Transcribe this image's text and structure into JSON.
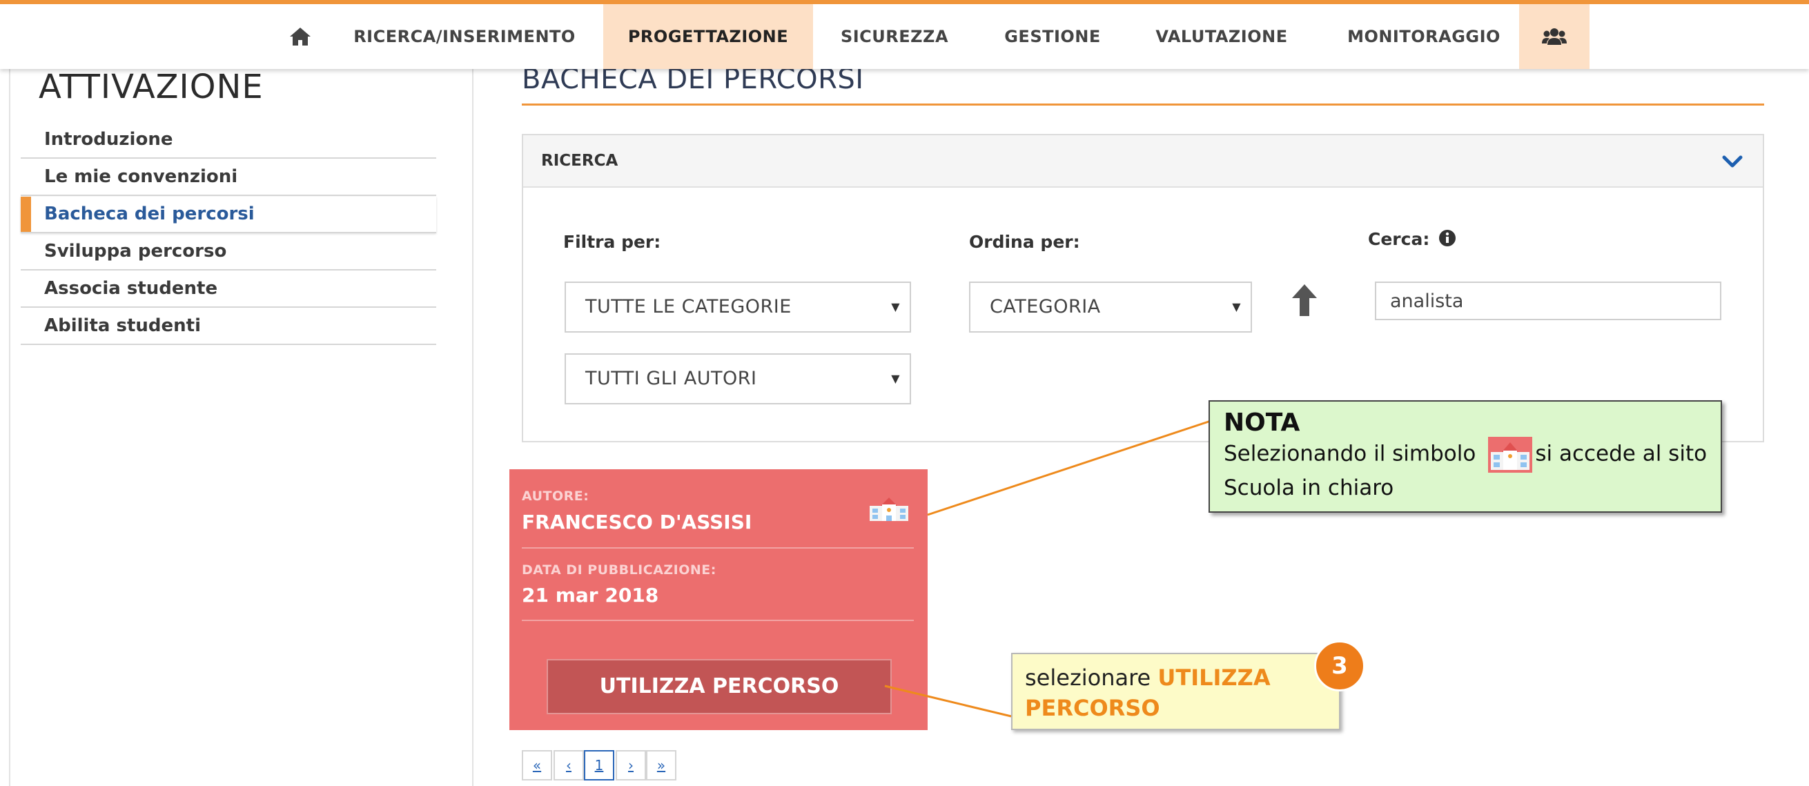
{
  "nav": {
    "items": [
      {
        "label": "RICERCA/INSERIMENTO"
      },
      {
        "label": "PROGETTAZIONE"
      },
      {
        "label": "SICUREZZA"
      },
      {
        "label": "GESTIONE"
      },
      {
        "label": "VALUTAZIONE"
      },
      {
        "label": "MONITORAGGIO"
      }
    ],
    "home_icon": "home-icon",
    "users_icon": "users-icon",
    "accent": "#f0953a",
    "highlight": "#fde0c6"
  },
  "sidebar": {
    "title": "ATTIVAZIONE",
    "items": [
      {
        "label": "Introduzione"
      },
      {
        "label": "Le mie convenzioni"
      },
      {
        "label": "Bacheca dei percorsi"
      },
      {
        "label": "Sviluppa percorso"
      },
      {
        "label": "Associa studente"
      },
      {
        "label": "Abilita studenti"
      }
    ]
  },
  "main": {
    "title": "BACHECA DEI PERCORSI",
    "search": {
      "header": "RICERCA",
      "filter_label": "Filtra per:",
      "filter_category": "TUTTE LE CATEGORIE",
      "filter_author": "TUTTI GLI AUTORI",
      "order_label": "Ordina per:",
      "order_value": "CATEGORIA",
      "search_label": "Cerca:",
      "search_value": "analista"
    },
    "card": {
      "author_label": "AUTORE:",
      "author": "FRANCESCO D'ASSISI",
      "date_label": "DATA DI PUBBLICAZIONE:",
      "date": "21 mar 2018",
      "button": "UTILIZZA PERCORSO",
      "color": "#ec6e6e"
    },
    "pagination": {
      "first": "«",
      "prev": "‹",
      "page": "1",
      "next": "›",
      "last": "»"
    }
  },
  "callouts": {
    "nota_title": "NOTA",
    "nota_text_before": "Selezionando il simbolo",
    "nota_text_after": "si accede al sito",
    "nota_text_line2": "Scuola in chiaro",
    "select_text": "selezionare",
    "select_emph_1": "UTILIZZA",
    "select_emph_2": "PERCORSO",
    "step": "3"
  }
}
